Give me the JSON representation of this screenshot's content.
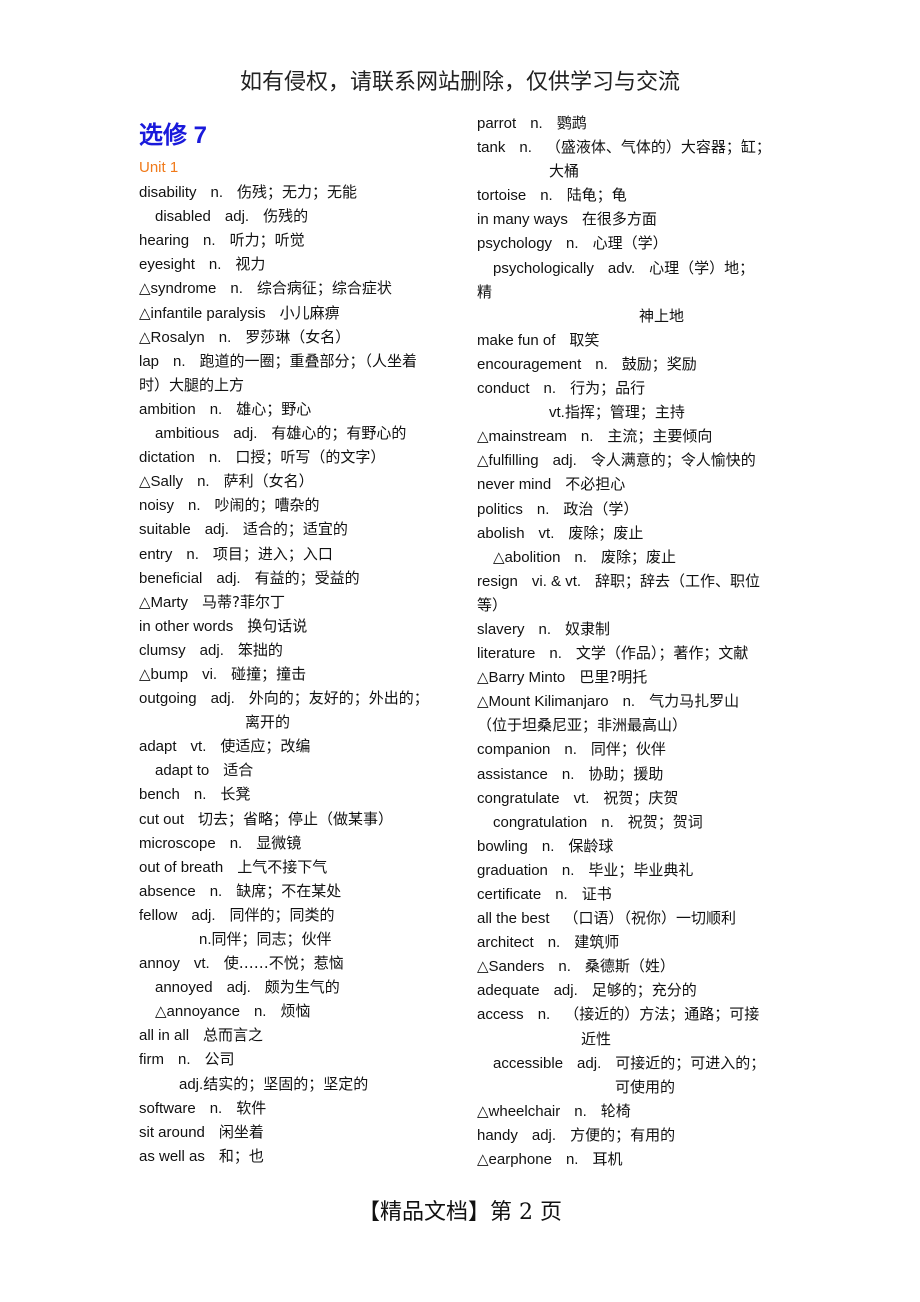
{
  "header": {
    "text": "如有侵权，请联系网站删除，仅供学习与交流"
  },
  "footer": {
    "text": "【精品文档】第 2 页"
  },
  "title": "选修 7",
  "unit": "Unit 1",
  "left_entries": [
    {
      "word": "disability",
      "pos": "n.",
      "meaning": "伤残；无力；无能",
      "indent": 0
    },
    {
      "word": "disabled",
      "pos": "adj.",
      "meaning": "伤残的",
      "indent": 1
    },
    {
      "word": "hearing",
      "pos": "n.",
      "meaning": "听力；听觉",
      "indent": 0
    },
    {
      "word": "eyesight",
      "pos": "n.",
      "meaning": "视力",
      "indent": 0
    },
    {
      "word": "△syndrome",
      "pos": "n.",
      "meaning": "综合病征；综合症状",
      "indent": 0
    },
    {
      "word": "△infantile paralysis",
      "pos": "",
      "meaning": "小儿麻痹",
      "indent": 0
    },
    {
      "word": "△Rosalyn",
      "pos": "n.",
      "meaning": "罗莎琳（女名）",
      "indent": 0
    },
    {
      "word": "lap",
      "pos": "n.",
      "meaning": "跑道的一圈；重叠部分；（人坐着",
      "indent": 0
    },
    {
      "word": "",
      "pos": "",
      "meaning": "时）大腿的上方",
      "indent": 0,
      "continuation": true
    },
    {
      "word": "ambition",
      "pos": "n.",
      "meaning": "雄心；野心",
      "indent": 0
    },
    {
      "word": "ambitious",
      "pos": "adj.",
      "meaning": "有雄心的；有野心的",
      "indent": 1
    },
    {
      "word": "dictation",
      "pos": "n.",
      "meaning": "口授；听写（的文字）",
      "indent": 0
    },
    {
      "word": "△Sally",
      "pos": "n.",
      "meaning": "萨利（女名）",
      "indent": 0
    },
    {
      "word": "noisy",
      "pos": "n.",
      "meaning": "吵闹的；嘈杂的",
      "indent": 0
    },
    {
      "word": "suitable",
      "pos": "adj.",
      "meaning": "适合的；适宜的",
      "indent": 0
    },
    {
      "word": "entry",
      "pos": "n.",
      "meaning": "项目；进入；入口",
      "indent": 0
    },
    {
      "word": "beneficial",
      "pos": "adj.",
      "meaning": "有益的；受益的",
      "indent": 0
    },
    {
      "word": "△Marty",
      "pos": "",
      "meaning": "马蒂?菲尔丁",
      "indent": 0
    },
    {
      "word": "in other words",
      "pos": "",
      "meaning": "换句话说",
      "indent": 0
    },
    {
      "word": "clumsy",
      "pos": "adj.",
      "meaning": "笨拙的",
      "indent": 0
    },
    {
      "word": "△bump",
      "pos": "vi.",
      "meaning": "碰撞；撞击",
      "indent": 0
    },
    {
      "word": "outgoing",
      "pos": "adj.",
      "meaning": "外向的；友好的；外出的；",
      "indent": 0
    },
    {
      "word": "",
      "pos": "",
      "meaning": "离开的",
      "indent": 4,
      "continuation": true
    },
    {
      "word": "adapt",
      "pos": "vt.",
      "meaning": "使适应；改编",
      "indent": 0
    },
    {
      "word": "adapt to",
      "pos": "",
      "meaning": "适合",
      "indent": 1
    },
    {
      "word": "bench",
      "pos": "n.",
      "meaning": "长凳",
      "indent": 0
    },
    {
      "word": "cut out",
      "pos": "",
      "meaning": "切去；省略；停止（做某事）",
      "indent": 0
    },
    {
      "word": "microscope",
      "pos": "n.",
      "meaning": "显微镜",
      "indent": 0
    },
    {
      "word": "out of breath",
      "pos": "",
      "meaning": "上气不接下气",
      "indent": 0
    },
    {
      "word": "absence",
      "pos": "n.",
      "meaning": "缺席；不在某处",
      "indent": 0
    },
    {
      "word": "fellow",
      "pos": "adj.",
      "meaning": "同伴的；同类的",
      "indent": 0
    },
    {
      "word": "",
      "pos": "n.",
      "meaning": "同伴；同志；伙伴",
      "indent": 3,
      "continuation": true
    },
    {
      "word": "annoy",
      "pos": "vt.",
      "meaning": "使……不悦；惹恼",
      "indent": 0
    },
    {
      "word": "annoyed",
      "pos": "adj.",
      "meaning": "颇为生气的",
      "indent": 1
    },
    {
      "word": "△annoyance",
      "pos": "n.",
      "meaning": "烦恼",
      "indent": 1
    },
    {
      "word": "all in all",
      "pos": "",
      "meaning": "总而言之",
      "indent": 0
    },
    {
      "word": "firm",
      "pos": "n.",
      "meaning": "公司",
      "indent": 0
    },
    {
      "word": "",
      "pos": "adj.",
      "meaning": "结实的；坚固的；坚定的",
      "indent": 2,
      "continuation": true
    },
    {
      "word": "software",
      "pos": "n.",
      "meaning": "软件",
      "indent": 0
    },
    {
      "word": "sit around",
      "pos": "",
      "meaning": "闲坐着",
      "indent": 0
    },
    {
      "word": "as well as",
      "pos": "",
      "meaning": "和；也",
      "indent": 0
    }
  ],
  "right_entries": [
    {
      "word": "parrot",
      "pos": "n.",
      "meaning": "鹦鹉",
      "indent": 0
    },
    {
      "word": "tank",
      "pos": "n.",
      "meaning": "（盛液体、气体的）大容器；缸；",
      "indent": 0
    },
    {
      "word": "",
      "pos": "",
      "meaning": "大桶",
      "indent": 5,
      "continuation": true
    },
    {
      "word": "tortoise",
      "pos": "n.",
      "meaning": "陆龟；龟",
      "indent": 0
    },
    {
      "word": "in many ways",
      "pos": "",
      "meaning": "在很多方面",
      "indent": 0
    },
    {
      "word": "psychology",
      "pos": "n.",
      "meaning": "心理（学）",
      "indent": 0
    },
    {
      "word": "psychologically",
      "pos": "adv.",
      "meaning": "心理（学）地；",
      "indent": 1
    },
    {
      "word": "",
      "pos": "",
      "meaning": "精",
      "indent": 0,
      "continuation": true
    },
    {
      "word": "",
      "pos": "",
      "meaning": "神上地",
      "indent": 7,
      "continuation": true
    },
    {
      "word": "make fun of",
      "pos": "",
      "meaning": "取笑",
      "indent": 0
    },
    {
      "word": "encouragement",
      "pos": "n.",
      "meaning": "鼓励；奖励",
      "indent": 0
    },
    {
      "word": "conduct",
      "pos": "n.",
      "meaning": "行为；品行",
      "indent": 0
    },
    {
      "word": "",
      "pos": "vt.",
      "meaning": "指挥；管理；主持",
      "indent": 5,
      "continuation": true
    },
    {
      "word": "△mainstream",
      "pos": "n.",
      "meaning": "主流；主要倾向",
      "indent": 0
    },
    {
      "word": "△fulfilling",
      "pos": "adj.",
      "meaning": "令人满意的；令人愉快的",
      "indent": 0
    },
    {
      "word": "never mind",
      "pos": "",
      "meaning": "不必担心",
      "indent": 0
    },
    {
      "word": "politics",
      "pos": "n.",
      "meaning": "政治（学）",
      "indent": 0
    },
    {
      "word": "abolish",
      "pos": "vt.",
      "meaning": "废除；废止",
      "indent": 0
    },
    {
      "word": "△abolition",
      "pos": "n.",
      "meaning": "废除；废止",
      "indent": 1
    },
    {
      "word": "resign",
      "pos": "vi. & vt.",
      "meaning": "辞职；辞去（工作、职位",
      "indent": 0
    },
    {
      "word": "",
      "pos": "",
      "meaning": "等）",
      "indent": 0,
      "continuation": true
    },
    {
      "word": "slavery",
      "pos": "n.",
      "meaning": "奴隶制",
      "indent": 0
    },
    {
      "word": "literature",
      "pos": "n.",
      "meaning": "文学（作品）；著作；文献",
      "indent": 0
    },
    {
      "word": "△Barry Minto",
      "pos": "",
      "meaning": "巴里?明托",
      "indent": 0
    },
    {
      "word": "△Mount Kilimanjaro",
      "pos": "n.",
      "meaning": "气力马扎罗山",
      "indent": 0
    },
    {
      "word": "",
      "pos": "",
      "meaning": "（位于坦桑尼亚；非洲最高山）",
      "indent": 0,
      "continuation": true
    },
    {
      "word": "companion",
      "pos": "n.",
      "meaning": "同伴；伙伴",
      "indent": 0
    },
    {
      "word": "assistance",
      "pos": "n.",
      "meaning": "协助；援助",
      "indent": 0
    },
    {
      "word": "congratulate",
      "pos": "vt.",
      "meaning": "祝贺；庆贺",
      "indent": 0
    },
    {
      "word": "congratulation",
      "pos": "n.",
      "meaning": "祝贺；贺词",
      "indent": 1
    },
    {
      "word": "bowling",
      "pos": "n.",
      "meaning": "保龄球",
      "indent": 0
    },
    {
      "word": "graduation",
      "pos": "n.",
      "meaning": "毕业；毕业典礼",
      "indent": 0
    },
    {
      "word": "certificate",
      "pos": "n.",
      "meaning": "证书",
      "indent": 0
    },
    {
      "word": "all the best",
      "pos": "",
      "meaning": "（口语）（祝你）一切顺利",
      "indent": 0
    },
    {
      "word": "architect",
      "pos": "n.",
      "meaning": "建筑师",
      "indent": 0
    },
    {
      "word": "△Sanders",
      "pos": "n.",
      "meaning": "桑德斯（姓）",
      "indent": 0
    },
    {
      "word": "adequate",
      "pos": "adj.",
      "meaning": "足够的；充分的",
      "indent": 0
    },
    {
      "word": "access",
      "pos": "n.",
      "meaning": "（接近的）方法；通路；可接",
      "indent": 0
    },
    {
      "word": "",
      "pos": "",
      "meaning": "近性",
      "indent": 8,
      "continuation": true
    },
    {
      "word": "accessible",
      "pos": "adj.",
      "meaning": "可接近的；可进入的；",
      "indent": 1
    },
    {
      "word": "",
      "pos": "",
      "meaning": "可使用的",
      "indent": 6,
      "continuation": true
    },
    {
      "word": "△wheelchair",
      "pos": "n.",
      "meaning": "轮椅",
      "indent": 0
    },
    {
      "word": "handy",
      "pos": "adj.",
      "meaning": "方便的；有用的",
      "indent": 0
    },
    {
      "word": "△earphone",
      "pos": "n.",
      "meaning": "耳机",
      "indent": 0
    }
  ],
  "colors": {
    "title": "#1a1adb",
    "unit": "#f07a1a",
    "text": "#111111"
  }
}
